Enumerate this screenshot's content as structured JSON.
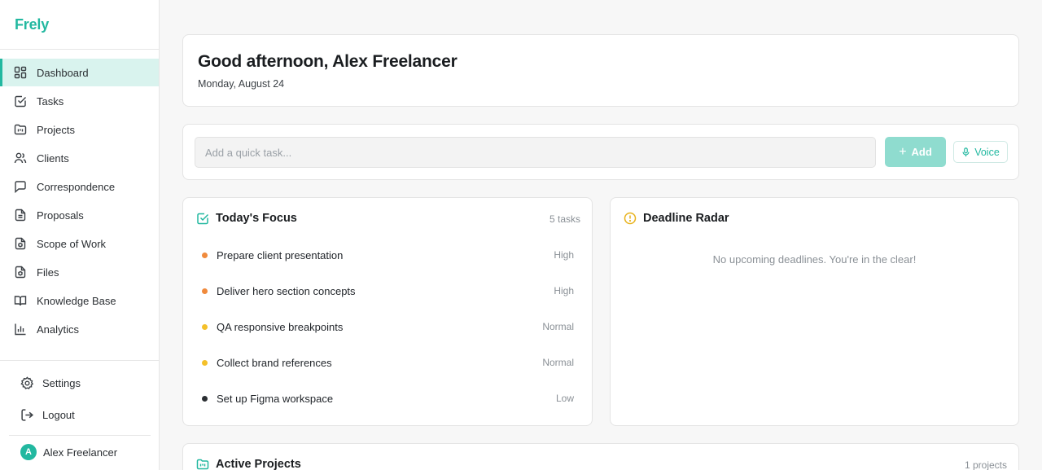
{
  "app": {
    "brand": "Frely"
  },
  "sidebar": {
    "items": [
      {
        "label": "Dashboard",
        "icon": "dashboard-icon",
        "active": true
      },
      {
        "label": "Tasks",
        "icon": "tasks-icon"
      },
      {
        "label": "Projects",
        "icon": "projects-icon"
      },
      {
        "label": "Clients",
        "icon": "clients-icon"
      },
      {
        "label": "Correspondence",
        "icon": "chat-icon"
      },
      {
        "label": "Proposals",
        "icon": "document-icon"
      },
      {
        "label": "Scope of Work",
        "icon": "scope-icon"
      },
      {
        "label": "Files",
        "icon": "files-icon"
      },
      {
        "label": "Knowledge Base",
        "icon": "book-icon"
      },
      {
        "label": "Analytics",
        "icon": "analytics-icon"
      }
    ],
    "bottom": [
      {
        "label": "Settings",
        "icon": "gear-icon"
      },
      {
        "label": "Logout",
        "icon": "logout-icon"
      }
    ],
    "user": {
      "initial": "A",
      "name": "Alex Freelancer"
    }
  },
  "header": {
    "greeting": "Good afternoon, Alex Freelancer",
    "date": "Monday, August 24"
  },
  "quick_task": {
    "placeholder": "Add a quick task...",
    "value": "",
    "add_label": "Add",
    "voice_label": "Voice"
  },
  "focus": {
    "title": "Today's Focus",
    "count": "5 tasks",
    "tasks": [
      {
        "name": "Prepare client presentation",
        "priority": "High",
        "color": "#f08a3c"
      },
      {
        "name": "Deliver hero section concepts",
        "priority": "High",
        "color": "#f08a3c"
      },
      {
        "name": "QA responsive breakpoints",
        "priority": "Normal",
        "color": "#f4c02a"
      },
      {
        "name": "Collect brand references",
        "priority": "Normal",
        "color": "#f4c02a"
      },
      {
        "name": "Set up Figma workspace",
        "priority": "Low",
        "color": "#2b2f33"
      }
    ]
  },
  "radar": {
    "title": "Deadline Radar",
    "empty": "No upcoming deadlines. You're in the clear!"
  },
  "projects": {
    "title": "Active Projects",
    "count": "1 projects"
  },
  "colors": {
    "accent": "#22b8a0",
    "accent_light": "#d9f3ee",
    "add_button": "#8fdccf",
    "high": "#f08a3c",
    "normal": "#f4c02a",
    "low": "#2b2f33",
    "warning": "#e8b21b"
  }
}
